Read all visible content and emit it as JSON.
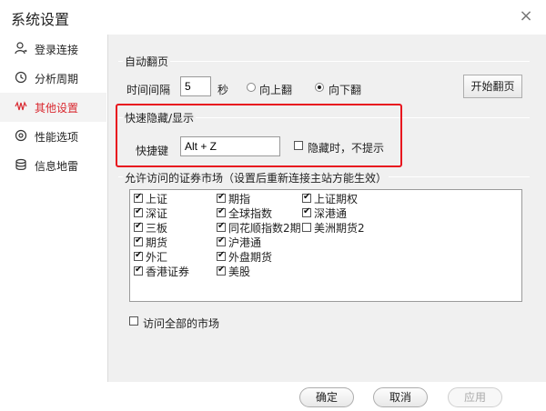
{
  "window": {
    "title": "系统设置",
    "close_glyph": "×"
  },
  "sidebar": {
    "items": [
      {
        "label": "登录连接",
        "icon": "user-login-icon",
        "active": false
      },
      {
        "label": "分析周期",
        "icon": "clock-cycle-icon",
        "active": false
      },
      {
        "label": "其他设置",
        "icon": "wave-settings-icon",
        "active": true
      },
      {
        "label": "性能选项",
        "icon": "gauge-icon",
        "active": false
      },
      {
        "label": "信息地雷",
        "icon": "database-icon",
        "active": false
      }
    ]
  },
  "auto_page": {
    "group_title": "自动翻页",
    "interval_label": "时间间隔",
    "interval_value": "5",
    "unit": "秒",
    "option_up": "向上翻",
    "option_down": "向下翻",
    "selected": "向下翻",
    "start_button": "开始翻页"
  },
  "quick_hide": {
    "group_title": "快速隐藏/显示",
    "hotkey_label": "快捷键",
    "hotkey_value": "Alt + Z",
    "no_prompt_label": "隐藏时，不提示",
    "no_prompt_checked": false
  },
  "markets": {
    "group_title": "允许访问的证券市场（设置后重新连接主站方能生效）",
    "columns": [
      [
        {
          "label": "上证",
          "checked": true
        },
        {
          "label": "深证",
          "checked": true
        },
        {
          "label": "三板",
          "checked": true
        },
        {
          "label": "期货",
          "checked": true
        },
        {
          "label": "外汇",
          "checked": true
        },
        {
          "label": "香港证券",
          "checked": true
        }
      ],
      [
        {
          "label": "期指",
          "checked": true
        },
        {
          "label": "全球指数",
          "checked": true
        },
        {
          "label": "同花顺指数2期",
          "checked": true
        },
        {
          "label": "沪港通",
          "checked": true
        },
        {
          "label": "外盘期货",
          "checked": true
        },
        {
          "label": "美股",
          "checked": true
        }
      ],
      [
        {
          "label": "上证期权",
          "checked": true
        },
        {
          "label": "深港通",
          "checked": true
        },
        {
          "label": "美洲期货2",
          "checked": false
        }
      ]
    ],
    "access_all_label": "访问全部的市场",
    "access_all_checked": false
  },
  "footer": {
    "ok": "确定",
    "cancel": "取消",
    "apply": "应用"
  },
  "colors": {
    "accent": "#d9282f",
    "highlight_frame": "#e8141e"
  }
}
